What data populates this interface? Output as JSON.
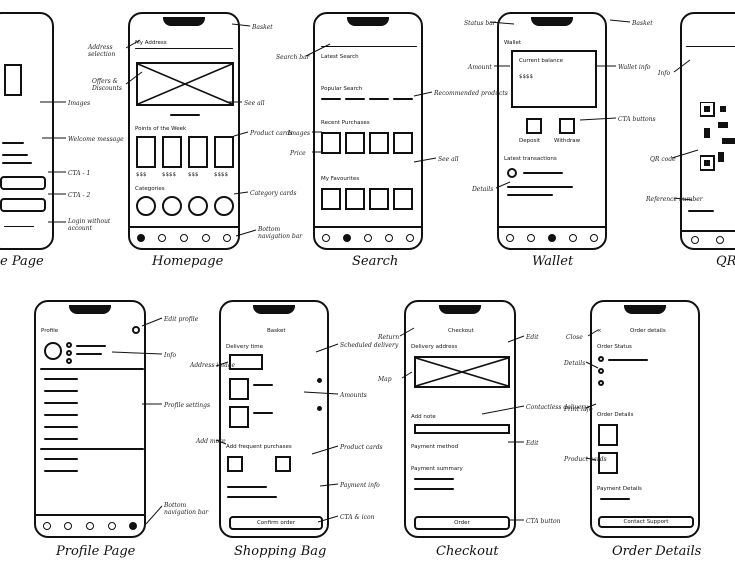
{
  "screens": [
    {
      "id": "landing",
      "caption": "e Page"
    },
    {
      "id": "homepage",
      "caption": "Homepage",
      "header": "My Address",
      "section": "Points of the Week",
      "section2": "Categories"
    },
    {
      "id": "search",
      "caption": "Search",
      "header": "Latest Search",
      "section": "Popular Search",
      "section2": "Recent Purchases",
      "section3": "My Favourites",
      "nav_label": "Search"
    },
    {
      "id": "wallet",
      "caption": "Wallet",
      "header": "Wallet",
      "card_title": "Current balance",
      "card_amount": "$$$$",
      "cta1": "Deposit",
      "cta2": "Withdraw",
      "history": "Latest transactions",
      "nav_label": "Wallet"
    },
    {
      "id": "qr",
      "caption": "QR"
    },
    {
      "id": "profile",
      "caption": "Profile Page",
      "header": "Profile"
    },
    {
      "id": "bag",
      "caption": "Shopping Bag",
      "header": "Basket",
      "section": "Delivery time",
      "section2": "Add frequent purchases",
      "cta": "Confirm order"
    },
    {
      "id": "checkout",
      "caption": "Checkout",
      "header": "Checkout",
      "section": "Delivery address",
      "section2": "Add note",
      "section3": "Payment method",
      "section4": "Payment summary",
      "cta": "Order"
    },
    {
      "id": "orderdetails",
      "caption": "Order Details",
      "header": "Order details",
      "section": "Order Status",
      "section2": "Order Details",
      "section3": "Payment Details",
      "cta": "Contact Support"
    }
  ],
  "annotations": {
    "landing": [
      "Images",
      "Welcome message",
      "CTA - 1",
      "CTA - 2",
      "Login without account"
    ],
    "home": [
      "Address selection",
      "Offers & Discounts",
      "See all",
      "Product cards",
      "Category cards",
      "Bottom navigation bar",
      "Basket"
    ],
    "search": [
      "Search bar",
      "Recommended products",
      "Images",
      "Price",
      "See all"
    ],
    "wallet": [
      "Status bar",
      "Amount",
      "Wallet info",
      "CTA buttons",
      "Details",
      "Basket"
    ],
    "qr": [
      "Info",
      "QR code",
      "Reference number"
    ],
    "profile": [
      "Edit profile",
      "Info",
      "Profile settings",
      "Bottom navigation bar"
    ],
    "bag": [
      "Scheduled delivery",
      "Address image",
      "Amounts",
      "Add more",
      "Product cards",
      "Payment info",
      "CTA & icon"
    ],
    "checkout": [
      "Return",
      "Edit",
      "Map",
      "Contactless delivery",
      "Edit",
      "CTA button"
    ],
    "orderdetails": [
      "Close",
      "Details",
      "Print info",
      "Product cards"
    ]
  },
  "labels": {
    "deposit": "Deposit",
    "withdraw": "Withdraw",
    "price": "$$$$",
    "price_short": "$$$"
  }
}
